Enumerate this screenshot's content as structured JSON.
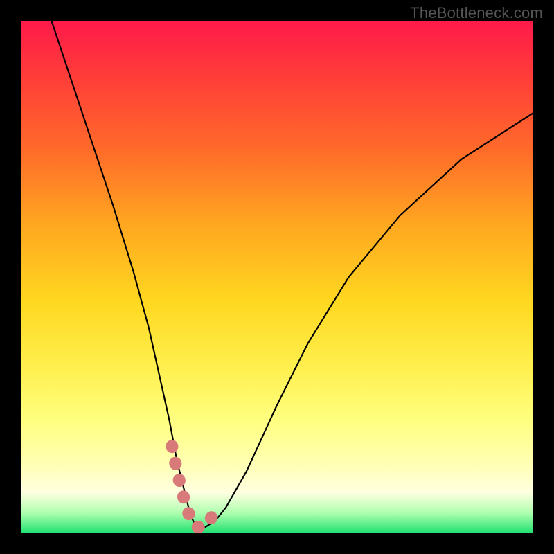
{
  "watermark": "TheBottleneck.com",
  "chart_data": {
    "type": "line",
    "title": "",
    "xlabel": "",
    "ylabel": "",
    "xlim": [
      0,
      100
    ],
    "ylim": [
      0,
      100
    ],
    "series": [
      {
        "name": "bottleneck-curve",
        "x": [
          6,
          10,
          14,
          18,
          22,
          25,
          27,
          29,
          30.5,
          32,
          33,
          34,
          35,
          36,
          38,
          40,
          44,
          50,
          56,
          64,
          74,
          86,
          100
        ],
        "values": [
          100,
          88,
          76,
          64,
          51,
          40,
          31,
          22,
          14,
          8,
          4,
          1.5,
          1,
          1.2,
          2.5,
          5,
          12,
          25,
          37,
          50,
          62,
          73,
          82
        ]
      },
      {
        "name": "highlight-segment",
        "x": [
          29.5,
          30.5,
          31.5,
          32.5,
          33.5,
          34.5,
          35.5,
          36.5,
          37.5,
          38.5
        ],
        "values": [
          17,
          12,
          8,
          4.5,
          2,
          1.2,
          1.2,
          2,
          3.5,
          6
        ]
      }
    ],
    "highlight_color": "#d97a7a",
    "curve_color": "#000000"
  }
}
